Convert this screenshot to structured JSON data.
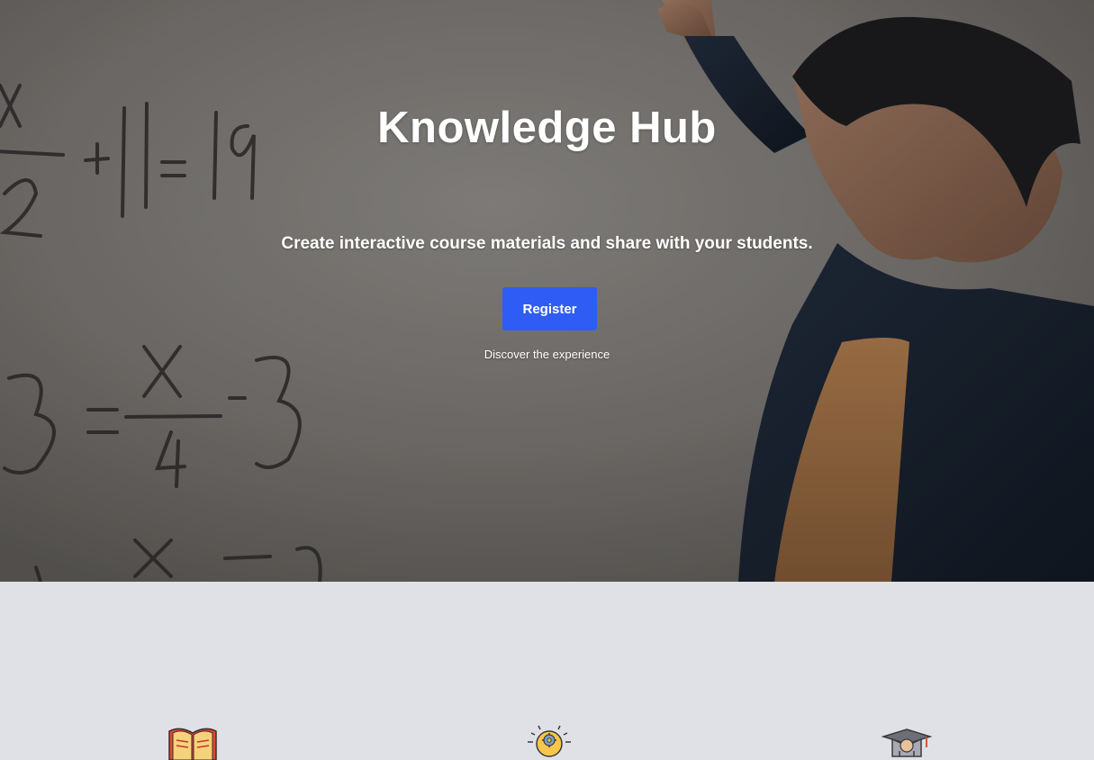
{
  "hero": {
    "title": "Knowledge Hub",
    "subtitle": "Create interactive course materials and share with your students.",
    "register_label": "Register",
    "discover_label": "Discover the experience",
    "background_image": "teacher-at-whiteboard-photo"
  },
  "features": {
    "icons": [
      {
        "name": "open-book-icon"
      },
      {
        "name": "lightbulb-gear-icon"
      },
      {
        "name": "graduation-cap-icon"
      }
    ]
  },
  "colors": {
    "accent": "#2f5cf5",
    "page_background": "#dfe1e6",
    "hero_text": "#ffffff"
  }
}
